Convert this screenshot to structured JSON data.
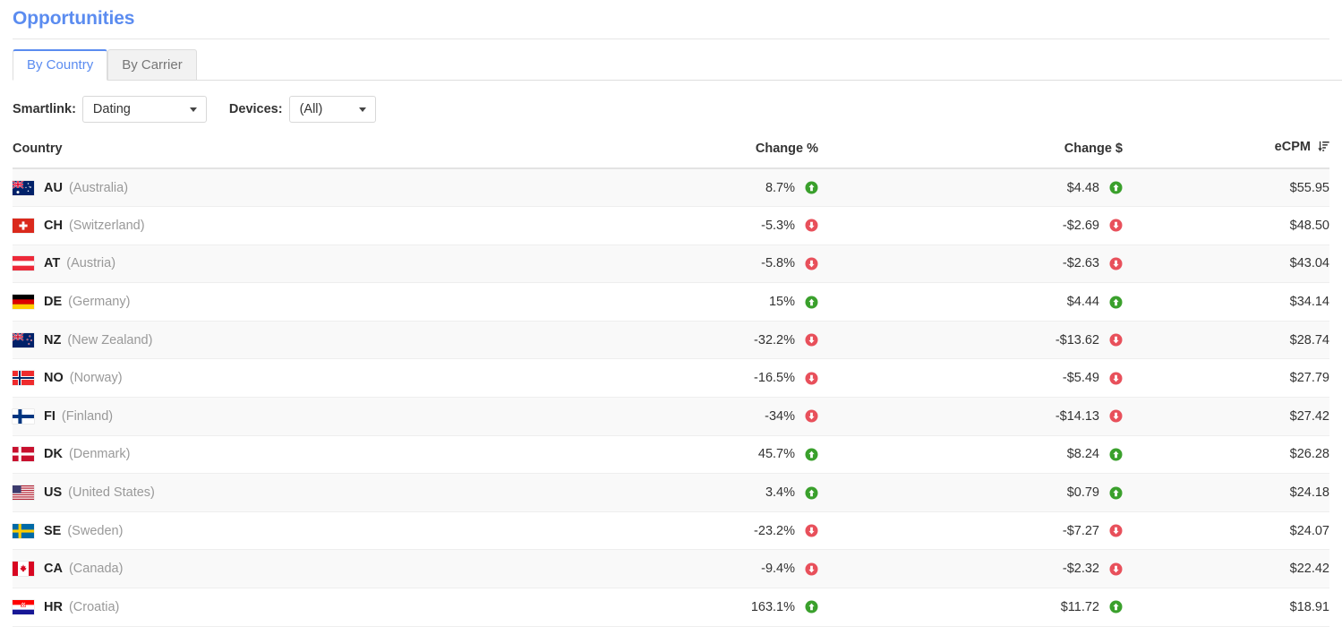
{
  "header": {
    "title": "Opportunities"
  },
  "tabs": [
    {
      "label": "By Country",
      "active": true
    },
    {
      "label": "By Carrier",
      "active": false
    }
  ],
  "filters": {
    "smartlink_label": "Smartlink:",
    "smartlink_value": "Dating",
    "devices_label": "Devices:",
    "devices_value": "(All)"
  },
  "table": {
    "columns": [
      {
        "key": "country",
        "label": "Country",
        "align": "left"
      },
      {
        "key": "change_pct",
        "label": "Change %",
        "align": "right"
      },
      {
        "key": "change_usd",
        "label": "Change $",
        "align": "right"
      },
      {
        "key": "ecpm",
        "label": "eCPM",
        "align": "right",
        "sort_icon": "sort-amount-desc-icon",
        "sorted": true
      }
    ],
    "rows": [
      {
        "code": "AU",
        "name": "(Australia)",
        "flag": "au",
        "change_pct": "8.7%",
        "pct_dir": "up",
        "change_usd": "$4.48",
        "usd_dir": "up",
        "ecpm": "$55.95"
      },
      {
        "code": "CH",
        "name": "(Switzerland)",
        "flag": "ch",
        "change_pct": "-5.3%",
        "pct_dir": "down",
        "change_usd": "-$2.69",
        "usd_dir": "down",
        "ecpm": "$48.50"
      },
      {
        "code": "AT",
        "name": "(Austria)",
        "flag": "at",
        "change_pct": "-5.8%",
        "pct_dir": "down",
        "change_usd": "-$2.63",
        "usd_dir": "down",
        "ecpm": "$43.04"
      },
      {
        "code": "DE",
        "name": "(Germany)",
        "flag": "de",
        "change_pct": "15%",
        "pct_dir": "up",
        "change_usd": "$4.44",
        "usd_dir": "up",
        "ecpm": "$34.14"
      },
      {
        "code": "NZ",
        "name": "(New Zealand)",
        "flag": "nz",
        "change_pct": "-32.2%",
        "pct_dir": "down",
        "change_usd": "-$13.62",
        "usd_dir": "down",
        "ecpm": "$28.74"
      },
      {
        "code": "NO",
        "name": "(Norway)",
        "flag": "no",
        "change_pct": "-16.5%",
        "pct_dir": "down",
        "change_usd": "-$5.49",
        "usd_dir": "down",
        "ecpm": "$27.79"
      },
      {
        "code": "FI",
        "name": "(Finland)",
        "flag": "fi",
        "change_pct": "-34%",
        "pct_dir": "down",
        "change_usd": "-$14.13",
        "usd_dir": "down",
        "ecpm": "$27.42"
      },
      {
        "code": "DK",
        "name": "(Denmark)",
        "flag": "dk",
        "change_pct": "45.7%",
        "pct_dir": "up",
        "change_usd": "$8.24",
        "usd_dir": "up",
        "ecpm": "$26.28"
      },
      {
        "code": "US",
        "name": "(United States)",
        "flag": "us",
        "change_pct": "3.4%",
        "pct_dir": "up",
        "change_usd": "$0.79",
        "usd_dir": "up",
        "ecpm": "$24.18"
      },
      {
        "code": "SE",
        "name": "(Sweden)",
        "flag": "se",
        "change_pct": "-23.2%",
        "pct_dir": "down",
        "change_usd": "-$7.27",
        "usd_dir": "down",
        "ecpm": "$24.07"
      },
      {
        "code": "CA",
        "name": "(Canada)",
        "flag": "ca",
        "change_pct": "-9.4%",
        "pct_dir": "down",
        "change_usd": "-$2.32",
        "usd_dir": "down",
        "ecpm": "$22.42"
      },
      {
        "code": "HR",
        "name": "(Croatia)",
        "flag": "hr",
        "change_pct": "163.1%",
        "pct_dir": "up",
        "change_usd": "$11.72",
        "usd_dir": "up",
        "ecpm": "$18.91"
      }
    ]
  },
  "colors": {
    "title": "#5b8cf0",
    "tab_active": "#5b8cf0",
    "up": "#3aa02c",
    "down": "#e8505b",
    "row_alt": "#f9f9f9",
    "text": "#333333",
    "muted": "#999999"
  }
}
